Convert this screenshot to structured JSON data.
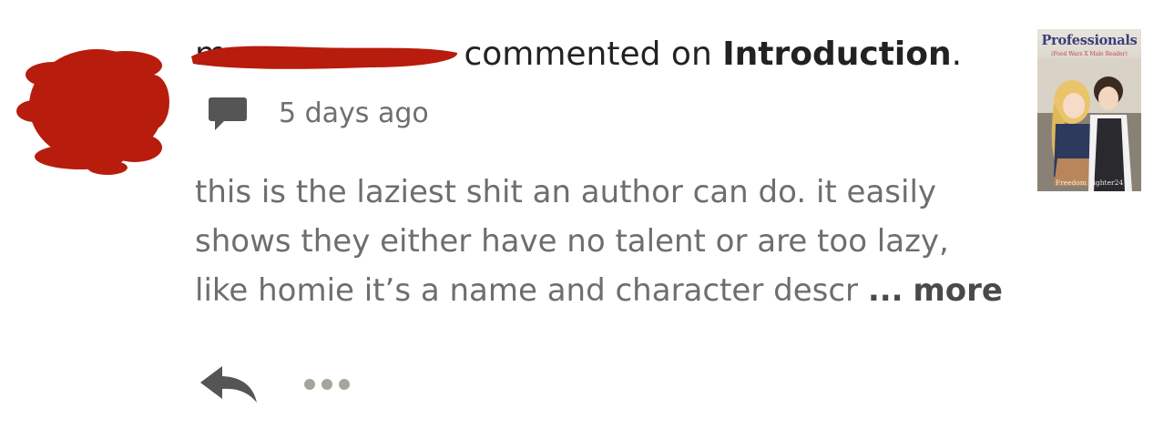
{
  "header": {
    "username": "m",
    "action_text": "commented on",
    "story_title": "Introduction",
    "period": "."
  },
  "meta": {
    "icon": "comment-bubble-icon",
    "time_ago": "5 days ago"
  },
  "comment": {
    "lines": [
      "this is the laziest shit an author can do. it easily",
      "shows they either have no talent or are too lazy,",
      "like homie it’s a name and character descr"
    ],
    "ellipsis": "...",
    "more_label": "more"
  },
  "actions": {
    "reply_icon": "reply-arrow-icon",
    "more_icon": "more-options-icon"
  },
  "cover": {
    "title": "Professionals",
    "subtitle": "(Food Wars X Male Reader)",
    "author": "Freedom Fighter24"
  },
  "colors": {
    "redaction": "#b71c0c",
    "text_primary": "#222222",
    "text_secondary": "#6e6e6e",
    "icon": "#555555",
    "dots": "#a8a39d"
  }
}
